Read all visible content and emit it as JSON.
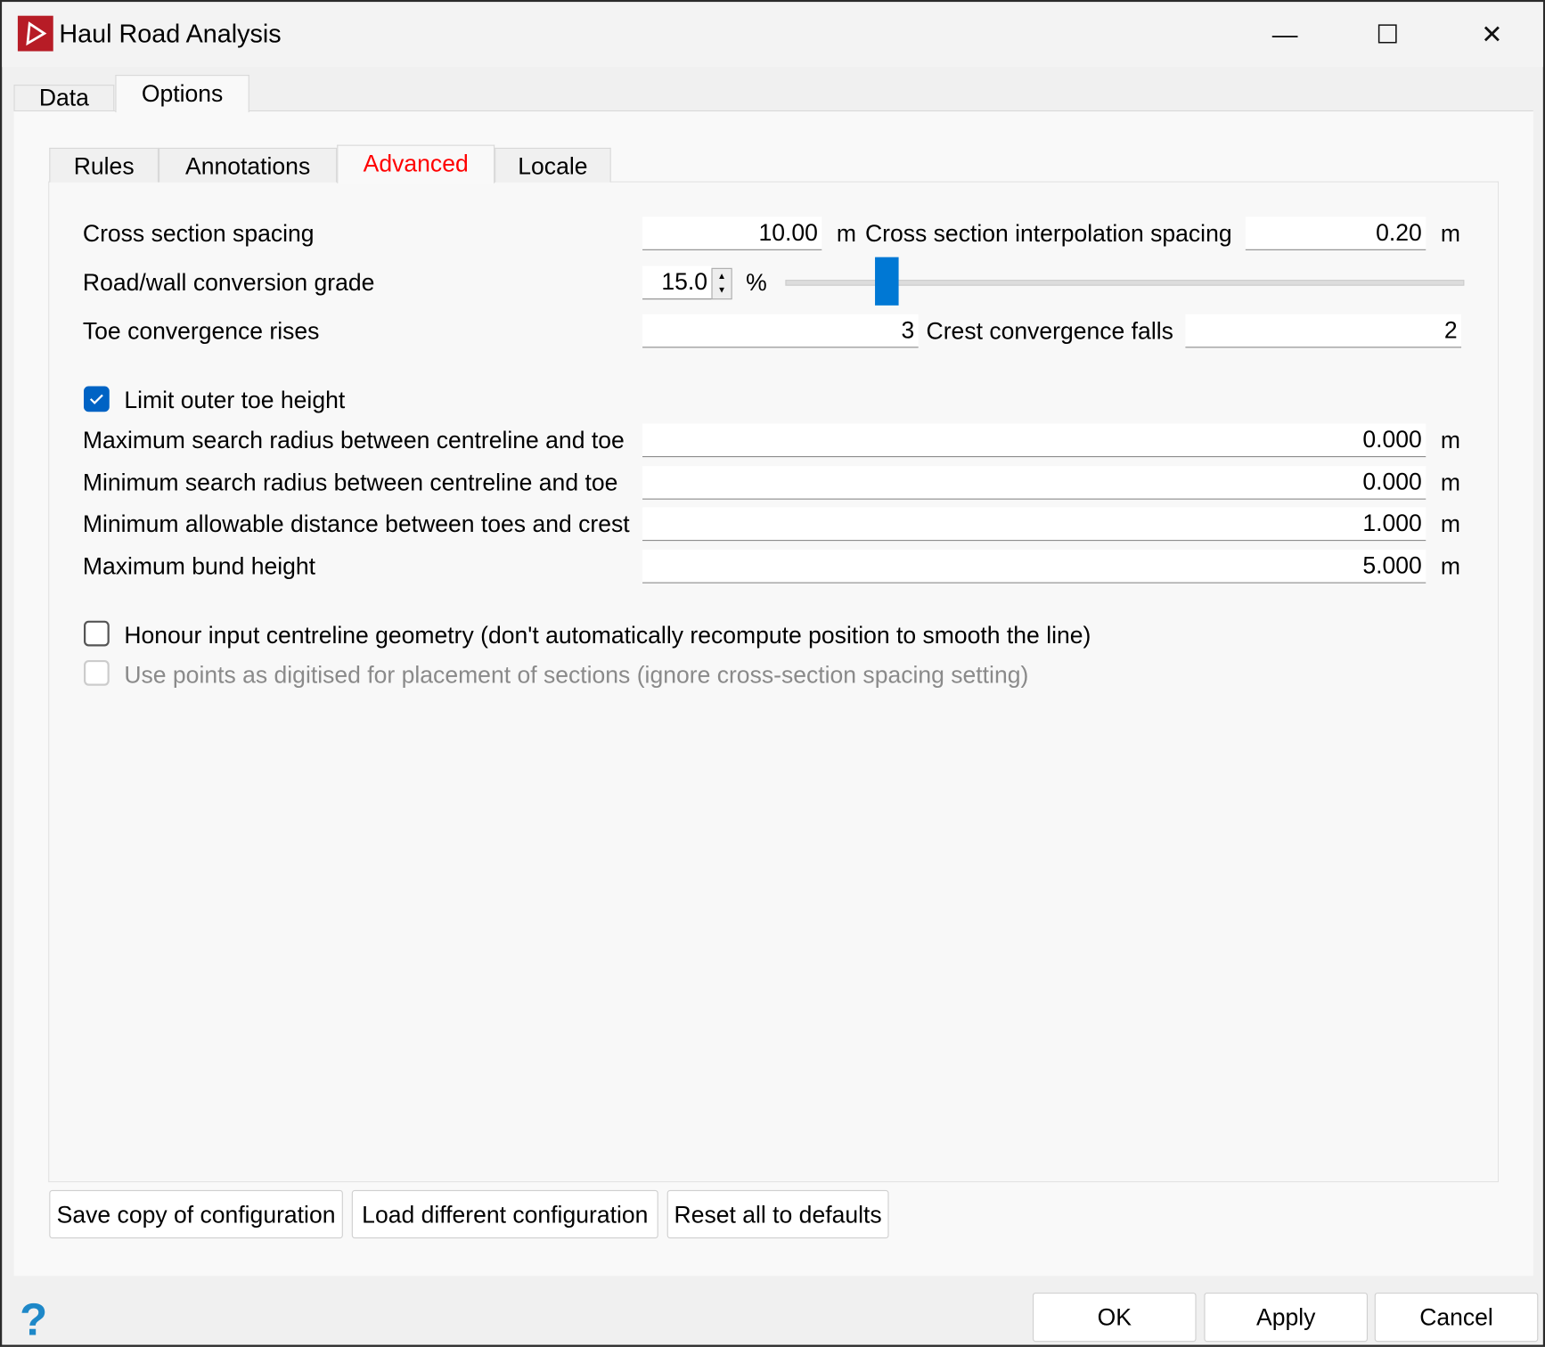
{
  "window": {
    "title": "Haul Road Analysis",
    "minimize": "—",
    "maximize": "☐",
    "close": "✕"
  },
  "main_tabs": [
    {
      "label": "Data"
    },
    {
      "label": "Options"
    }
  ],
  "sub_tabs": [
    {
      "label": "Rules"
    },
    {
      "label": "Annotations"
    },
    {
      "label": "Advanced"
    },
    {
      "label": "Locale"
    }
  ],
  "accent_color": "#0078d4",
  "active_tab_color": "#ff0000",
  "form": {
    "cross_section_spacing": {
      "label": "Cross section spacing",
      "value": "10.00",
      "unit": "m"
    },
    "interp_spacing": {
      "label": "Cross section interpolation spacing",
      "value": "0.20",
      "unit": "m"
    },
    "conversion_grade": {
      "label": "Road/wall conversion grade",
      "value": "15.0",
      "unit": "%",
      "slider_fraction": 0.15
    },
    "toe_rises": {
      "label": "Toe convergence rises",
      "value": "3"
    },
    "crest_falls": {
      "label": "Crest convergence falls",
      "value": "2"
    },
    "limit_toe": {
      "label": "Limit outer toe height",
      "checked": true
    },
    "max_search": {
      "label": "Maximum search radius between centreline and toe",
      "value": "0.000",
      "unit": "m"
    },
    "min_search": {
      "label": "Minimum search radius between centreline and toe",
      "value": "0.000",
      "unit": "m"
    },
    "min_dist": {
      "label": "Minimum allowable distance between toes and crest",
      "value": "1.000",
      "unit": "m"
    },
    "max_bund": {
      "label": "Maximum bund height",
      "value": "5.000",
      "unit": "m"
    },
    "honour": {
      "label": "Honour input centreline geometry (don't automatically recompute position to smooth the line)",
      "checked": false
    },
    "use_points": {
      "label": "Use points as digitised for placement of sections (ignore cross-section spacing setting)",
      "checked": false,
      "disabled": true
    }
  },
  "config_buttons": {
    "save": "Save copy of configuration",
    "load": "Load different configuration",
    "reset": "Reset all to defaults"
  },
  "footer": {
    "help": "?",
    "ok": "OK",
    "apply": "Apply",
    "cancel": "Cancel"
  }
}
